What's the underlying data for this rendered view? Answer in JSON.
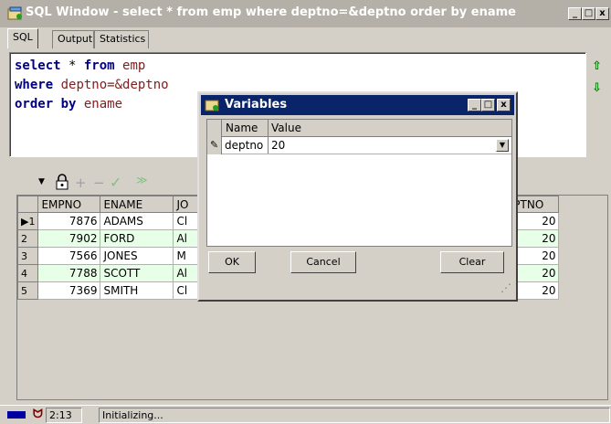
{
  "window": {
    "title": "SQL Window - select * from emp where deptno=&deptno order by ename",
    "minimize": "_",
    "restore": "□",
    "close": "x"
  },
  "tabs": [
    {
      "label": "SQL",
      "active": true
    },
    {
      "label": "Output",
      "active": false
    },
    {
      "label": "Statistics",
      "active": false
    }
  ],
  "editor": {
    "lines": [
      [
        {
          "t": "kw",
          "v": "select"
        },
        {
          "t": "plain",
          "v": " * "
        },
        {
          "t": "kw",
          "v": "from"
        },
        {
          "t": "id",
          "v": " emp"
        }
      ],
      [
        {
          "t": "kw",
          "v": "where"
        },
        {
          "t": "id",
          "v": " deptno=&deptno"
        }
      ],
      [
        {
          "t": "kw",
          "v": "order by"
        },
        {
          "t": "id",
          "v": " ename"
        }
      ]
    ],
    "scroll_up": "⇧",
    "scroll_down": "⇩"
  },
  "grid": {
    "columns": [
      "EMPNO",
      "ENAME",
      "JO",
      "",
      "",
      "",
      "DEPTNO"
    ],
    "rows": [
      {
        "no": "1",
        "empno": "7876",
        "ename": "ADAMS",
        "job": "Cl",
        "deptno": "20"
      },
      {
        "no": "2",
        "empno": "7902",
        "ename": "FORD",
        "job": "Al",
        "deptno": "20"
      },
      {
        "no": "3",
        "empno": "7566",
        "ename": "JONES",
        "job": "M",
        "deptno": "20"
      },
      {
        "no": "4",
        "empno": "7788",
        "ename": "SCOTT",
        "job": "Al",
        "deptno": "20"
      },
      {
        "no": "5",
        "empno": "7369",
        "ename": "SMITH",
        "job": "Cl",
        "deptno": "20"
      }
    ]
  },
  "status": {
    "time": "2:13",
    "message": "Initializing..."
  },
  "dialog": {
    "title": "Variables",
    "minimize": "_",
    "restore": "□",
    "close": "x",
    "columns": [
      "Name",
      "Value"
    ],
    "variable": {
      "name": "deptno",
      "value": "20"
    },
    "ok_label": "OK",
    "cancel_label": "Cancel",
    "clear_label": "Clear"
  },
  "colors": {
    "dialog_title_bg": "#0a246a",
    "inactive_title_bg": "#b4b0a8",
    "keyword": "#00007f",
    "even_row": "#e7ffe7"
  }
}
